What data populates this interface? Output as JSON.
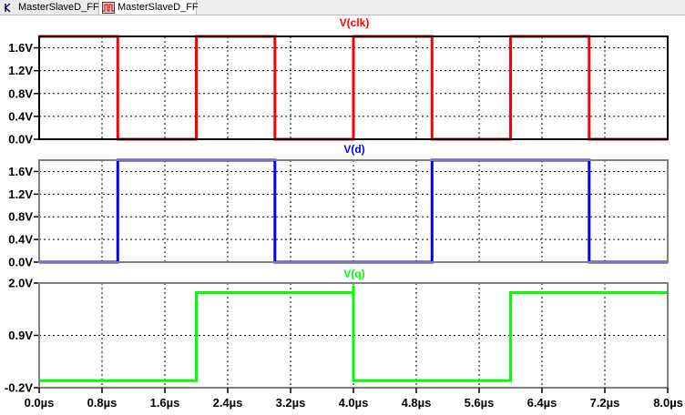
{
  "tabs": [
    {
      "label": "MasterSlaveD_FF",
      "icon": "schematic-icon"
    },
    {
      "label": "MasterSlaveD_FF",
      "icon": "waveform-icon",
      "active": true
    }
  ],
  "colors": {
    "clk": "#ff0000",
    "d": "#0000ff",
    "q": "#00ff00",
    "grid": "#000000",
    "frame_active": "#000000",
    "frame": "#808080"
  },
  "x_ticks": [
    "0.0µs",
    "0.8µs",
    "1.6µs",
    "2.4µs",
    "3.2µs",
    "4.0µs",
    "4.8µs",
    "5.6µs",
    "6.4µs",
    "7.2µs",
    "8.0µs"
  ],
  "chart_data": [
    {
      "type": "line",
      "title": "V(clk)",
      "xlim": [
        0,
        8
      ],
      "ylim": [
        0,
        1.8
      ],
      "y_ticks": [
        1.6,
        1.2,
        0.8,
        0.4,
        0.0
      ],
      "y_tick_labels": [
        "1.6V",
        "1.2V",
        "0.8V",
        "0.4V",
        "0.0V"
      ],
      "grid": true,
      "series": [
        {
          "name": "V(clk)",
          "color": "#ff0000",
          "x": [
            0,
            1,
            1,
            2,
            2,
            3,
            3,
            4,
            4,
            5,
            5,
            6,
            6,
            7,
            7,
            8
          ],
          "y": [
            1.8,
            1.8,
            0,
            0,
            1.8,
            1.8,
            0,
            0,
            1.8,
            1.8,
            0,
            0,
            1.8,
            1.8,
            0,
            0
          ]
        }
      ]
    },
    {
      "type": "line",
      "title": "V(d)",
      "xlim": [
        0,
        8
      ],
      "ylim": [
        0,
        1.8
      ],
      "y_ticks": [
        1.6,
        1.2,
        0.8,
        0.4,
        0.0
      ],
      "y_tick_labels": [
        "1.6V",
        "1.2V",
        "0.8V",
        "0.4V",
        "0.0V"
      ],
      "grid": true,
      "series": [
        {
          "name": "V(d)",
          "color": "#0000ff",
          "x": [
            0,
            1,
            1,
            3,
            3,
            5,
            5,
            7,
            7,
            8
          ],
          "y": [
            0,
            0,
            1.8,
            1.8,
            0,
            0,
            1.8,
            1.8,
            0,
            0
          ]
        }
      ]
    },
    {
      "type": "line",
      "title": "V(q)",
      "xlim": [
        0,
        8
      ],
      "ylim": [
        -0.2,
        2.0
      ],
      "y_ticks": [
        2.0,
        0.9,
        -0.2
      ],
      "y_tick_labels": [
        "2.0V",
        "0.9V",
        "-0.2V"
      ],
      "grid": true,
      "series": [
        {
          "name": "V(q)",
          "color": "#00ff00",
          "x": [
            0,
            2,
            2,
            4,
            4,
            4,
            6,
            6,
            8
          ],
          "y": [
            -0.05,
            -0.05,
            1.8,
            1.8,
            1.95,
            -0.05,
            -0.05,
            1.8,
            1.8
          ]
        }
      ]
    }
  ]
}
